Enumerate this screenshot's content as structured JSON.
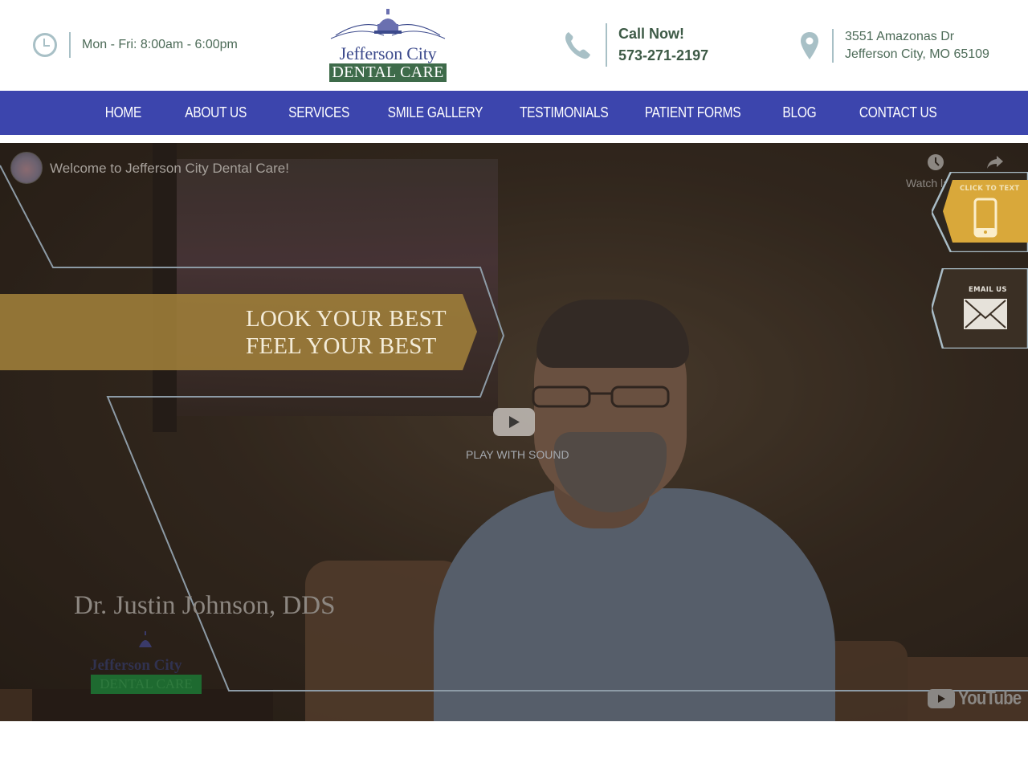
{
  "header": {
    "hours": "Mon - Fri: 8:00am - 6:00pm",
    "call_label": "Call Now!",
    "phone": "573-271-2197",
    "address_line1": "3551 Amazonas Dr",
    "address_line2": "Jefferson City, MO 65109",
    "logo": {
      "line1": "Jefferson City",
      "line2": "DENTAL CARE"
    },
    "icons": [
      "clock-icon",
      "phone-icon",
      "map-pin-icon"
    ]
  },
  "nav": {
    "items": [
      {
        "label": "HOME"
      },
      {
        "label": "ABOUT US"
      },
      {
        "label": "SERVICES"
      },
      {
        "label": "SMILE GALLERY"
      },
      {
        "label": "TESTIMONIALS"
      },
      {
        "label": "PATIENT FORMS"
      },
      {
        "label": "BLOG"
      },
      {
        "label": "CONTACT US"
      }
    ]
  },
  "hero": {
    "video_title": "Welcome to Jefferson City Dental Care!",
    "watch_later_label": "Watch later",
    "banner_line1": "LOOK YOUR BEST",
    "banner_line2": "FEEL YOUR BEST",
    "play_label": "PLAY WITH SOUND",
    "doctor_caption": "Dr. Justin Johnson, DDS",
    "video_logo_line1": "Jefferson City",
    "video_logo_line2": "DENTAL CARE",
    "youtube_label": "YouTube",
    "side_buttons": {
      "text_label": "CLICK TO TEXT",
      "email_label": "EMAIL US"
    }
  },
  "colors": {
    "nav_bg": "#3c45ad",
    "header_text": "#4d6b58",
    "icon_gray": "#a8c0c6",
    "logo_blue": "#3c4a8c",
    "logo_green": "#3e6b4a",
    "banner_gold": "#a07f3a",
    "text_button_gold": "#d9a83a"
  }
}
